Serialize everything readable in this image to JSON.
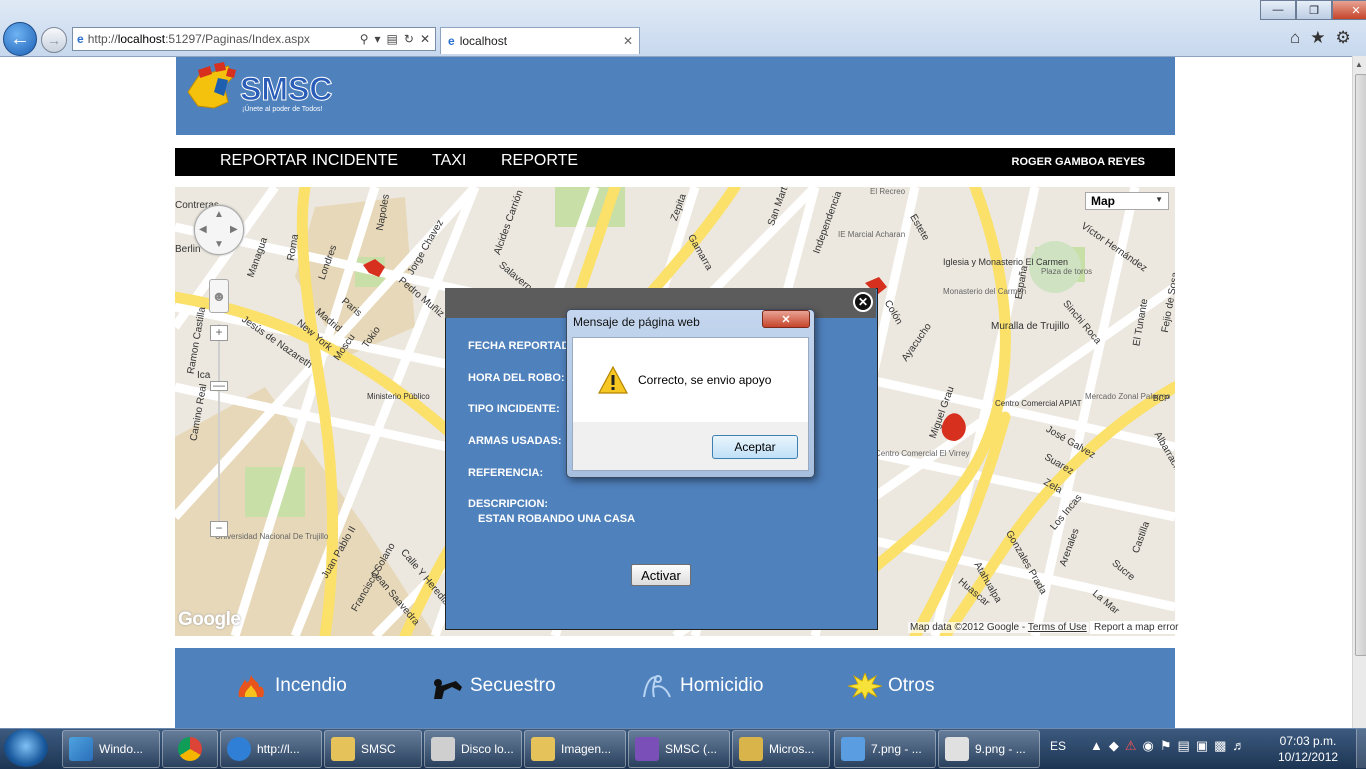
{
  "browser": {
    "address_prefix": "http://",
    "address_host": "localhost",
    "address_rest": ":51297/Paginas/Index.aspx",
    "tab_title": "localhost"
  },
  "site": {
    "logo_text": "SMSC",
    "logo_tagline": "¡Únete al poder de Todos!",
    "nav": [
      {
        "label": "REPORTAR INCIDENTE"
      },
      {
        "label": "TAXI"
      },
      {
        "label": "REPORTE"
      }
    ],
    "user_name": "ROGER GAMBOA REYES"
  },
  "map": {
    "type_selector": "Map",
    "attribution_text": "Map data ©2012 Google -",
    "terms_link": "Terms of Use",
    "error_link": "Report a map error",
    "google_mark": "Google",
    "labels": [
      "Jesús de Nazareth",
      "Ministerio Público",
      "Juan Pablo II",
      "Francisco Solano",
      "Dean Saavedra",
      "Calle Y Heredia",
      "Universidad Nacional De Trujillo",
      "Iglesia y Monasterio El Carmen",
      "Monasterio del Carmen",
      "Muralla de Trujillo",
      "España",
      "Plaza de toros",
      "Víctor Hernández",
      "Sinchi Roca",
      "Mercado Zonal Palermo",
      "Centro Comercial APIAT",
      "Miguel Grau",
      "José Galvez",
      "Suarez",
      "Zela",
      "Los Incas",
      "Gonzales Prada",
      "Atahualpa",
      "Huascar",
      "Ayacucho",
      "Colón",
      "Estete",
      "Zepita",
      "Gamarra",
      "Alcides Carrión",
      "Napoles",
      "Jorge Chavez",
      "Pedro Muñiz",
      "Londres",
      "Paris",
      "Madrid",
      "New York",
      "Moscu",
      "Tokio",
      "Roma",
      "Managua",
      "Berlin",
      "Contreras",
      "Ramon Castilla",
      "Camino Real",
      "Ica",
      "IE Marcial Acharan",
      "El Recreo",
      "Independencia",
      "San Martín",
      "Salaverry",
      "Castilla",
      "Sucre",
      "La Mar",
      "Arenales",
      "El Tunante",
      "Fejio de Sosa",
      "Albarracín",
      "BCP",
      "Centro Comercial El Virrey"
    ]
  },
  "incident_panel": {
    "fields": [
      {
        "label": "FECHA REPORTADO:"
      },
      {
        "label": "HORA DEL ROBO:"
      },
      {
        "label": "TIPO INCIDENTE:"
      },
      {
        "label": "ARMAS USADAS:"
      },
      {
        "label": "REFERENCIA:"
      },
      {
        "label": "DESCRIPCION:"
      }
    ],
    "description_value": "ESTAN ROBANDO UNA CASA",
    "action_button": "Activar"
  },
  "dialog": {
    "title": "Mensaje de página web",
    "message": "Correcto, se envio apoyo",
    "ok_button": "Aceptar"
  },
  "categories": [
    {
      "label": "Incendio",
      "icon": "fire-icon"
    },
    {
      "label": "Secuestro",
      "icon": "kidnap-icon"
    },
    {
      "label": "Homicidio",
      "icon": "homicide-icon"
    },
    {
      "label": "Otros",
      "icon": "burst-icon"
    }
  ],
  "taskbar": {
    "items": [
      {
        "label": "Windo..."
      },
      {
        "label": ""
      },
      {
        "label": "http://l..."
      },
      {
        "label": "SMSC"
      },
      {
        "label": "Disco lo..."
      },
      {
        "label": "Imagen..."
      },
      {
        "label": "SMSC (..."
      },
      {
        "label": "Micros..."
      },
      {
        "label": "7.png - ..."
      },
      {
        "label": "9.png - ..."
      }
    ],
    "language": "ES",
    "time": "07:03 p.m.",
    "date": "10/12/2012"
  }
}
